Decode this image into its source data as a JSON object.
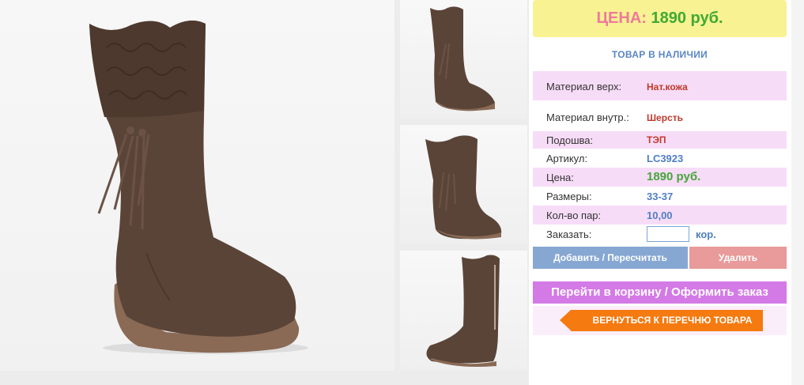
{
  "product": {
    "main_image_alt": "brown suede boot",
    "thumbnails": [
      "brown suede boot side view",
      "brown suede boot front view",
      "brown suede boot with zipper"
    ]
  },
  "price_box": {
    "label": "ЦЕНА:",
    "value": "1890 руб."
  },
  "stock_status": "ТОВАР В НАЛИЧИИ",
  "specs": {
    "material_top": {
      "label": "Материал верх:",
      "value": "Нат.кожа"
    },
    "material_inner": {
      "label": "Материал внутр.:",
      "value": "Шерсть"
    },
    "sole": {
      "label": "Подошва:",
      "value": "ТЭП"
    },
    "article": {
      "label": "Артикул:",
      "value": "LC3923"
    },
    "price": {
      "label": "Цена:",
      "value": "1890 руб."
    },
    "sizes": {
      "label": "Размеры:",
      "value": "33-37"
    },
    "pairs": {
      "label": "Кол-во пар:",
      "value": "10,00"
    }
  },
  "order": {
    "label": "Заказать:",
    "value": "",
    "unit": "кор."
  },
  "buttons": {
    "add": "Добавить / Пересчитать",
    "delete": "Удалить",
    "cart": "Перейти в корзину / Оформить заказ",
    "back": "ВЕРНУТЬСЯ К ПЕРЕЧНЮ ТОВАРА"
  },
  "colors": {
    "price_label": "#ee7a9a",
    "price_value": "#3faa34",
    "accent_blue": "#4f7ec3",
    "highlight_pink": "#f7dcf7",
    "back_orange": "#f57a0f"
  }
}
